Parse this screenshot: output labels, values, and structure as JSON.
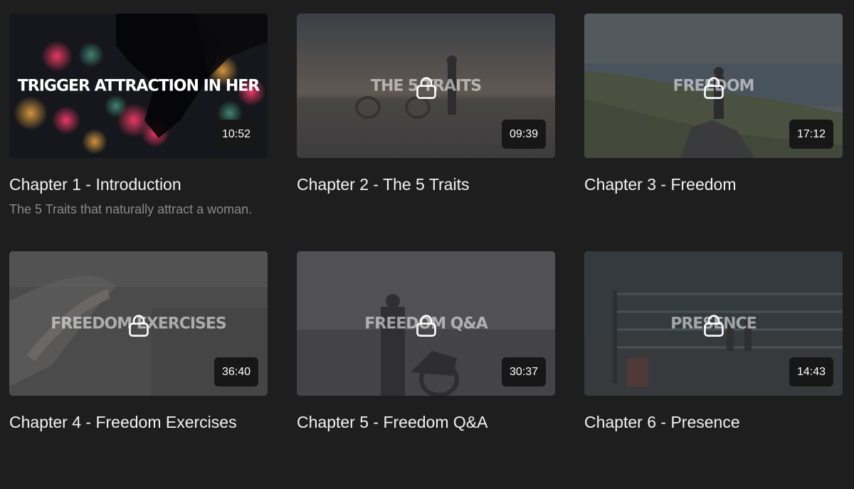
{
  "chapters": [
    {
      "overlay": "TRIGGER ATTRACTION IN HER",
      "duration": "10:52",
      "title": "Chapter 1 - Introduction",
      "description": "The 5 Traits that naturally attract a woman.",
      "locked": false
    },
    {
      "overlay": "THE 5 TRAITS",
      "duration": "09:39",
      "title": "Chapter 2 - The 5 Traits",
      "locked": true
    },
    {
      "overlay": "FREEDOM",
      "duration": "17:12",
      "title": "Chapter 3 - Freedom",
      "locked": true
    },
    {
      "overlay": "FREEDOM EXERCISES",
      "duration": "36:40",
      "title": "Chapter 4 - Freedom Exercises",
      "locked": true
    },
    {
      "overlay": "FREEDOM Q&A",
      "duration": "30:37",
      "title": "Chapter 5 - Freedom Q&A",
      "locked": true
    },
    {
      "overlay": "PRESENCE",
      "duration": "14:43",
      "title": "Chapter 6 - Presence",
      "locked": true
    }
  ],
  "icons": {
    "lock": "lock-icon"
  },
  "colors": {
    "background": "#1e1e1f",
    "duration_badge": "#171717",
    "description": "#8a8a8a"
  }
}
